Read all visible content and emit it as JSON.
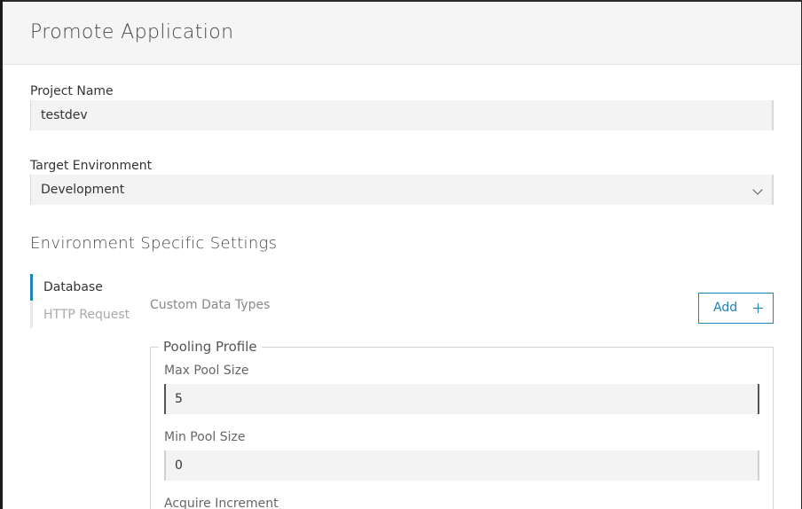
{
  "dialog": {
    "title": "Promote Application"
  },
  "project": {
    "label": "Project Name",
    "value": "testdev"
  },
  "target": {
    "label": "Target Environment",
    "selected": "Development"
  },
  "settings": {
    "title": "Environment Specific Settings",
    "tabs": [
      {
        "label": "Database",
        "active": true
      },
      {
        "label": "HTTP Request",
        "active": false
      }
    ],
    "custom_data_types_label": "Custom Data Types",
    "add_label": "Add"
  },
  "pooling": {
    "legend": "Pooling Profile",
    "max_label": "Max Pool Size",
    "max_value": "5",
    "min_label": "Min Pool Size",
    "min_value": "0",
    "acquire_label": "Acquire Increment"
  },
  "colors": {
    "accent": "#1c83b9",
    "header_bg": "#f5f5f5",
    "field_bg": "#f3f3f3"
  }
}
